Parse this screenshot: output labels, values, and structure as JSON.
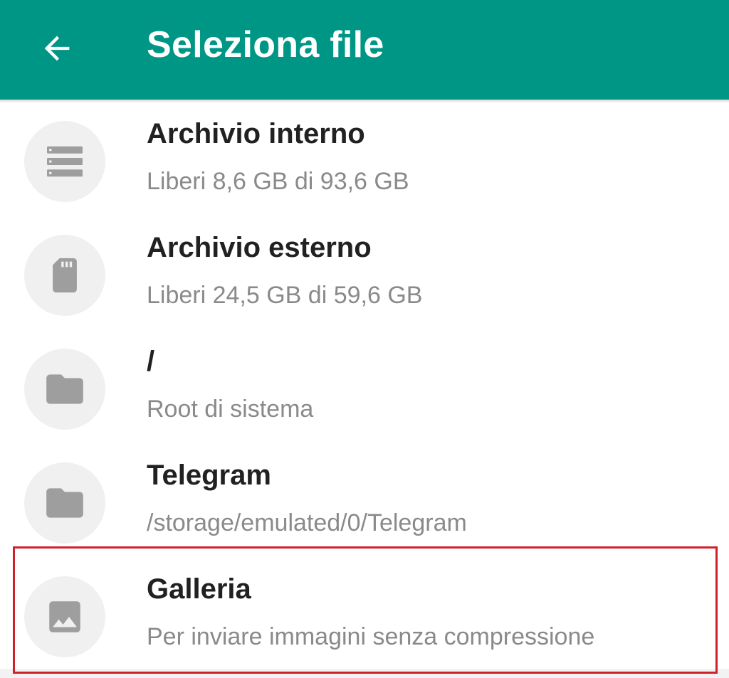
{
  "toolbar": {
    "title": "Seleziona file",
    "back_icon": "arrow-left-icon",
    "background_color": "#009685"
  },
  "items": [
    {
      "icon": "storage-list-icon",
      "title": "Archivio interno",
      "subtitle": "Liberi 8,6 GB di 93,6 GB"
    },
    {
      "icon": "sd-card-icon",
      "title": "Archivio esterno",
      "subtitle": "Liberi 24,5 GB di 59,6 GB"
    },
    {
      "icon": "folder-icon",
      "title": "/",
      "subtitle": "Root di sistema"
    },
    {
      "icon": "folder-icon",
      "title": "Telegram",
      "subtitle": "/storage/emulated/0/Telegram"
    },
    {
      "icon": "image-icon",
      "title": "Galleria",
      "subtitle": "Per inviare immagini senza compressione",
      "highlighted": true
    }
  ],
  "colors": {
    "icon_gray": "#9e9e9e",
    "icon_circle": "#f0f0f0",
    "title_text": "#212121",
    "subtitle_text": "#8a8a8a",
    "highlight_border": "#d0202a"
  }
}
